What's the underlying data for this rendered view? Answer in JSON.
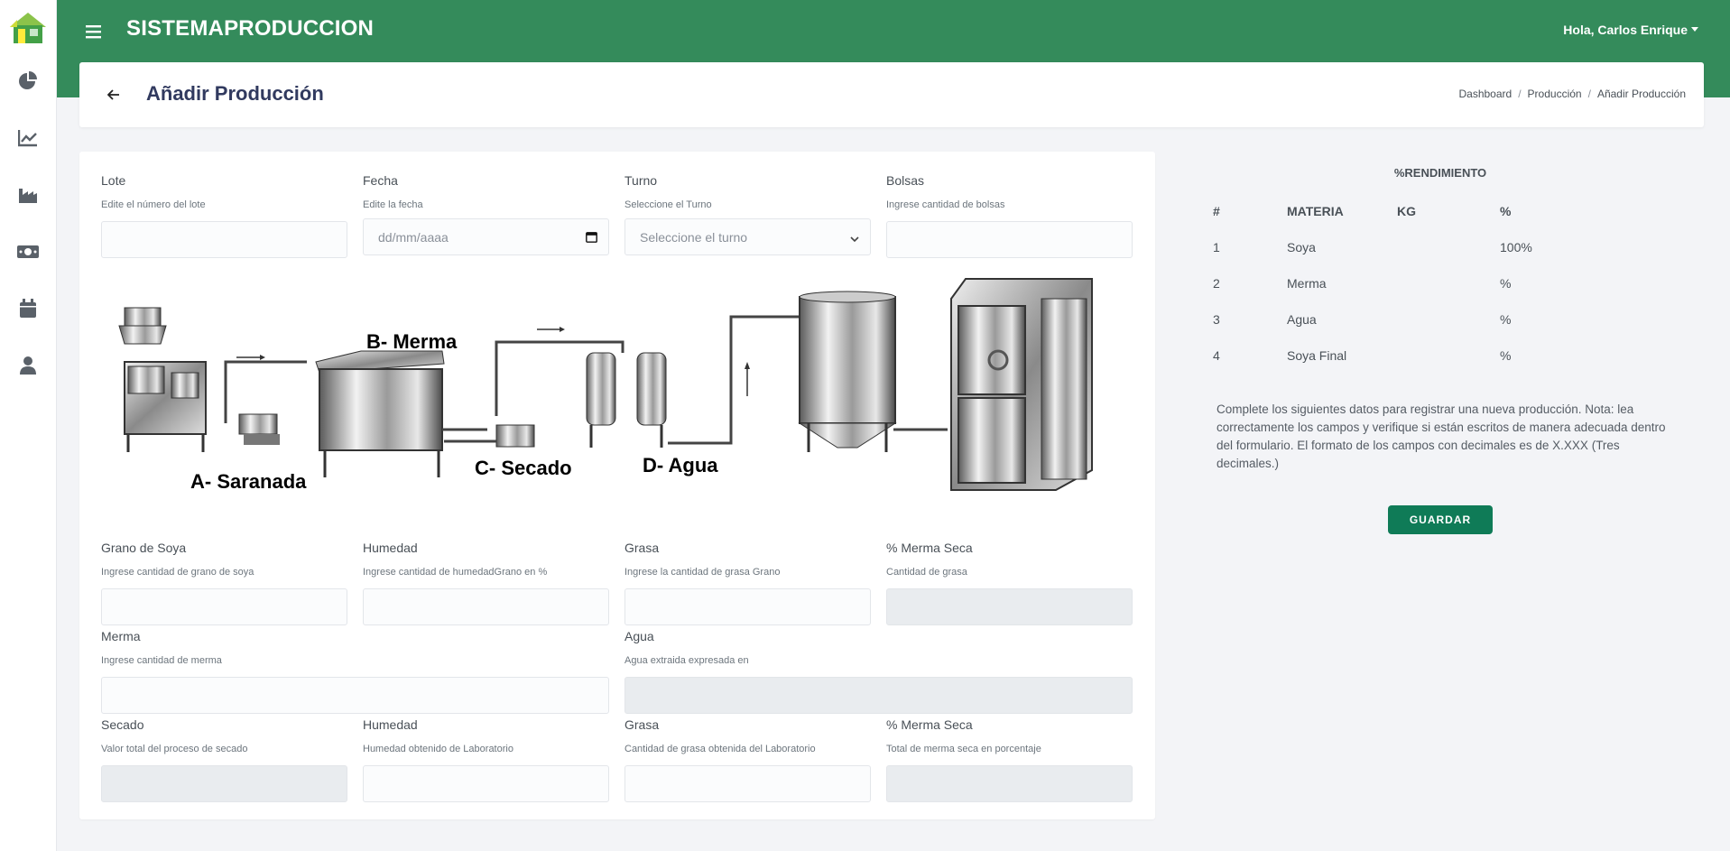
{
  "app": {
    "brand": "SISTEMAPRODUCCION",
    "user_greeting": "Hola, Carlos Enrique"
  },
  "sidebar": {
    "items": [
      {
        "icon": "pie-chart-icon"
      },
      {
        "icon": "line-chart-icon"
      },
      {
        "icon": "factory-icon"
      },
      {
        "icon": "money-icon"
      },
      {
        "icon": "calendar-icon"
      },
      {
        "icon": "user-icon"
      }
    ]
  },
  "header": {
    "title": "Añadir Producción",
    "breadcrumb": [
      "Dashboard",
      "Producción",
      "Añadir Producción"
    ],
    "breadcrumb_sep": "/"
  },
  "form": {
    "lote": {
      "label": "Lote",
      "help": "Edite el número del lote",
      "value": ""
    },
    "fecha": {
      "label": "Fecha",
      "help": "Edite la fecha",
      "placeholder": "dd/mm/aaaa"
    },
    "turno": {
      "label": "Turno",
      "help": "Seleccione el Turno",
      "selected": "Seleccione el turno"
    },
    "bolsas": {
      "label": "Bolsas",
      "help": "Ingrese cantidad de bolsas",
      "value": ""
    },
    "grano_soya": {
      "label": "Grano de Soya",
      "help": "Ingrese cantidad de grano de soya",
      "value": ""
    },
    "humedad1": {
      "label": "Humedad",
      "help": "Ingrese cantidad de humedadGrano en %",
      "value": ""
    },
    "grasa1": {
      "label": "Grasa",
      "help": "Ingrese la cantidad de grasa Grano",
      "value": ""
    },
    "merma_seca1": {
      "label": "% Merma Seca",
      "help": "Cantidad de grasa",
      "value": ""
    },
    "merma": {
      "label": "Merma",
      "help": "Ingrese cantidad de merma",
      "value": ""
    },
    "agua": {
      "label": "Agua",
      "help": "Agua extraida expresada en",
      "value": ""
    },
    "secado": {
      "label": "Secado",
      "help": "Valor total del proceso de secado",
      "value": ""
    },
    "humedad2": {
      "label": "Humedad",
      "help": "Humedad obtenido de Laboratorio",
      "value": ""
    },
    "grasa2": {
      "label": "Grasa",
      "help": "Cantidad de grasa obtenida del Laboratorio",
      "value": ""
    },
    "merma_seca2": {
      "label": "% Merma Seca",
      "help": "Total de merma seca en porcentaje",
      "value": ""
    }
  },
  "diagram": {
    "labels": {
      "a": "A- Saranada",
      "b": "B- Merma",
      "c": "C- Secado",
      "d": "D- Agua"
    }
  },
  "rendimiento": {
    "title": "%RENDIMIENTO",
    "columns": [
      "#",
      "MATERIA",
      "KG",
      "%"
    ],
    "rows": [
      {
        "n": "1",
        "materia": "Soya",
        "kg": "",
        "pct": "100%"
      },
      {
        "n": "2",
        "materia": "Merma",
        "kg": "",
        "pct": "%"
      },
      {
        "n": "3",
        "materia": "Agua",
        "kg": "",
        "pct": "%"
      },
      {
        "n": "4",
        "materia": "Soya Final",
        "kg": "",
        "pct": "%"
      }
    ],
    "note": "Complete los siguientes datos para registrar una nueva producción. Nota: lea correctamente los campos y verifique si están escritos de manera adecuada dentro del formulario. El formato de los campos con decimales es de X.XXX (Tres decimales.)",
    "save_label": "GUARDAR"
  },
  "colors": {
    "topbar": "#348b5b",
    "primary_button": "#0f7b57",
    "title": "#313a5f"
  }
}
